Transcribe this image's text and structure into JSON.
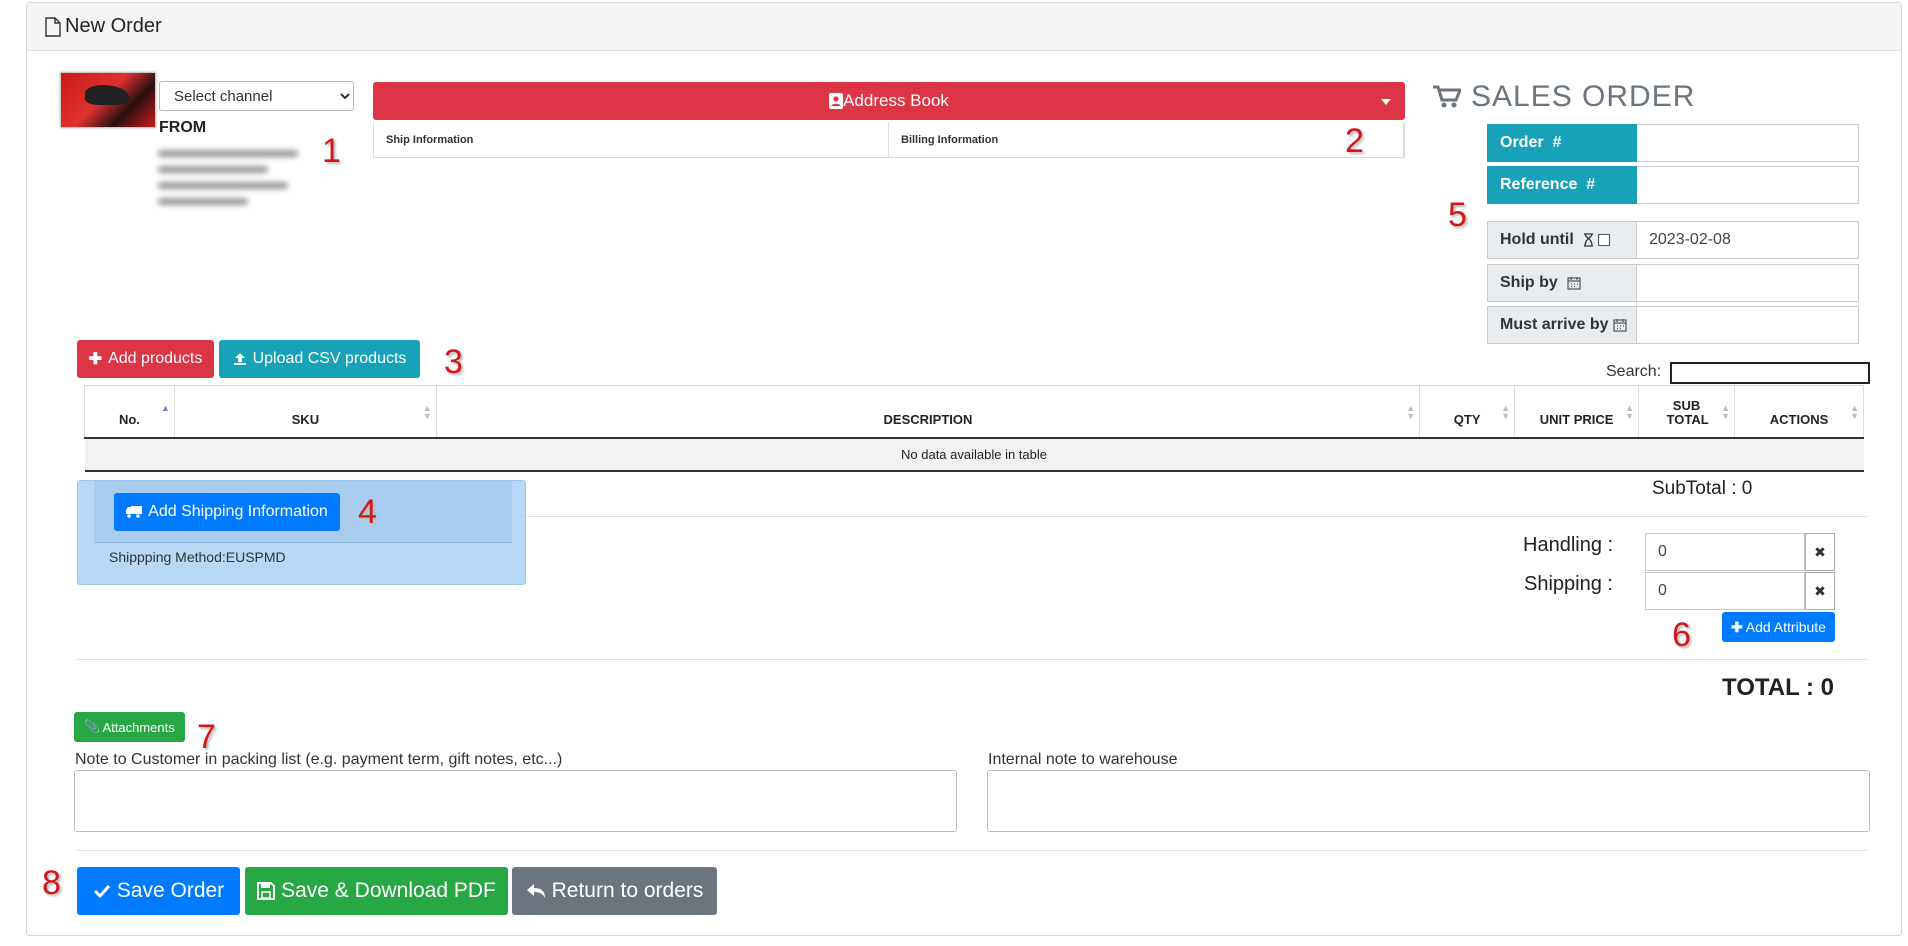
{
  "header": {
    "title": "New Order"
  },
  "from": {
    "channel_select": "Select channel",
    "label": "FROM"
  },
  "address_book": {
    "label": "Address Book",
    "tabs": [
      "Ship Information",
      "Billing Information"
    ]
  },
  "sales_order": {
    "title": "SALES ORDER",
    "fields": [
      {
        "label": "Order",
        "value": ""
      },
      {
        "label": "Reference",
        "value": ""
      },
      {
        "label": "Hold until",
        "value": "2023-02-08"
      },
      {
        "label": "Ship by",
        "value": ""
      },
      {
        "label": "Must arrive by",
        "value": ""
      }
    ]
  },
  "products": {
    "add_label": "Add products",
    "upload_label": "Upload CSV products",
    "search_label": "Search:"
  },
  "table": {
    "columns": [
      "No.",
      "SKU",
      "DESCRIPTION",
      "QTY",
      "UNIT PRICE",
      "SUB TOTAL",
      "ACTIONS"
    ],
    "empty_text": "No data available in table"
  },
  "subtotal": "SubTotal : 0",
  "shipping": {
    "add_label": "Add Shipping Information",
    "method": "Shippping Method:EUSPMD"
  },
  "charges": {
    "handling_label": "Handling :",
    "handling_value": "0",
    "shipping_label": "Shipping :",
    "shipping_value": "0",
    "add_attribute": "Add Attribute"
  },
  "total": "TOTAL : 0",
  "attachments_label": "Attachments",
  "notes": {
    "customer_label": "Note to Customer in packing list (e.g. payment term, gift notes, etc...)",
    "warehouse_label": "Internal note to warehouse"
  },
  "footer": {
    "save": "Save Order",
    "save_pdf": "Save & Download PDF",
    "return": "Return to orders"
  },
  "annotations": [
    "1",
    "2",
    "3",
    "4",
    "5",
    "6",
    "7",
    "8"
  ],
  "colors": {
    "red": "#dc3545",
    "teal": "#17a2b8",
    "blue": "#007bff",
    "green": "#28a745",
    "grey": "#6c757d",
    "annotation": "#d01818"
  }
}
